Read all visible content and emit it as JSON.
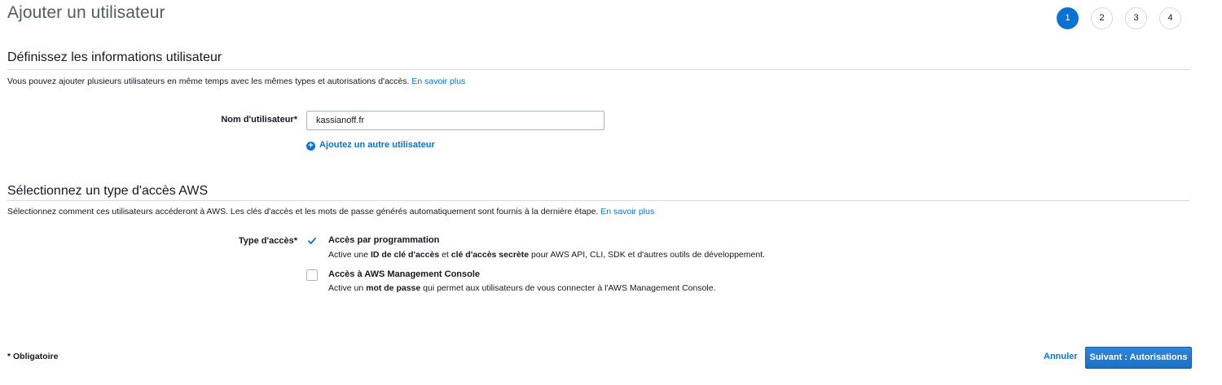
{
  "page": {
    "title": "Ajouter un utilisateur",
    "steps": [
      "1",
      "2",
      "3",
      "4"
    ],
    "active_step": "1"
  },
  "details": {
    "title": "Définissez les informations utilisateur",
    "description": "Vous pouvez ajouter plusieurs utilisateurs en même temps avec les mêmes types et autorisations d'accès.",
    "learn_more": "En savoir plus",
    "username_label": "Nom d'utilisateur*",
    "username_value": "kassianoff.fr",
    "add_user": "Ajoutez un autre utilisateur",
    "add_user_icon": "plus-circle-icon"
  },
  "access": {
    "title": "Sélectionnez un type d'accès AWS",
    "description": "Sélectionnez comment ces utilisateurs accéderont à AWS. Les clés d'accès et les mots de passe générés automatiquement sont fournis à la dernière étape.",
    "learn_more": "En savoir plus",
    "type_label": "Type d'accès*",
    "options": [
      {
        "title": "Accès par programmation",
        "checked": true,
        "desc_parts": [
          "Active une ",
          "ID de clé d'accès",
          " et ",
          "clé d'accès secrète",
          " pour AWS API, CLI, SDK et d'autres outils de développement."
        ]
      },
      {
        "title": "Accès à AWS Management Console",
        "checked": false,
        "desc_parts": [
          "Active un ",
          "mot de passe",
          " qui permet aux utilisateurs de vous connecter à l'AWS Management Console."
        ]
      }
    ]
  },
  "footer": {
    "required_note": "* Obligatoire",
    "cancel_label": "Annuler",
    "next_label": "Suivant : Autorisations"
  },
  "colors": {
    "accent": "#0972d3",
    "text": "#16191f",
    "muted": "#545b64",
    "border": "#d5dbdb"
  }
}
